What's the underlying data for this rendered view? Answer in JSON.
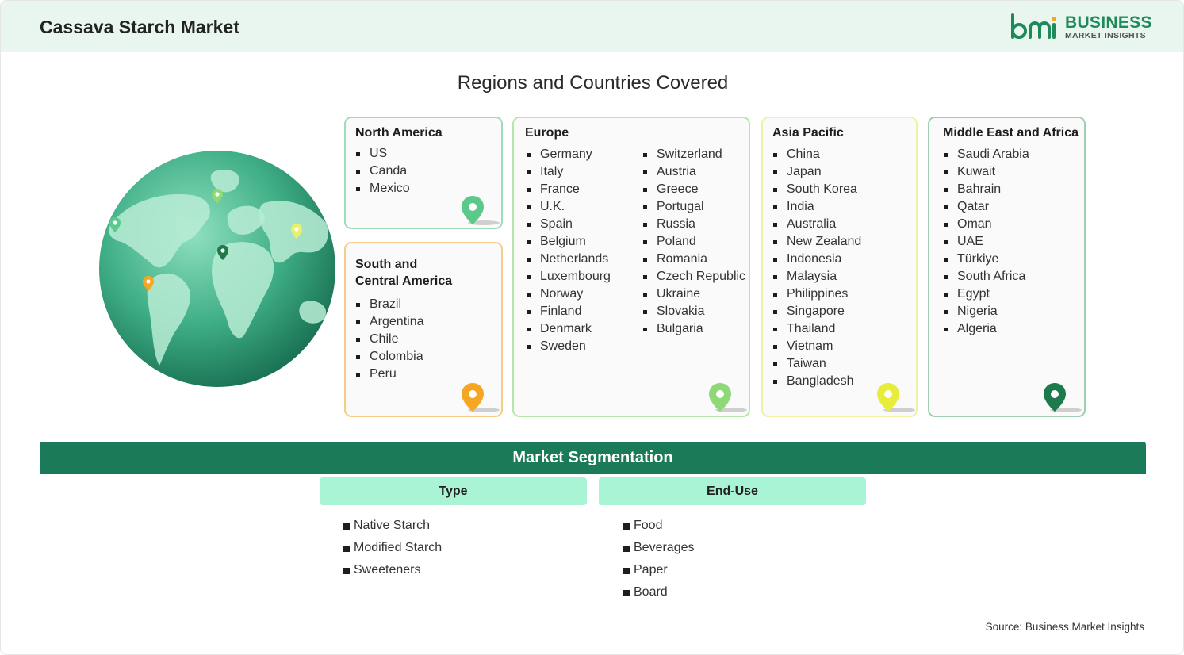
{
  "header": {
    "title": "Cassava Starch Market"
  },
  "logo": {
    "line1": "BUSINESS",
    "line2": "MARKET INSIGHTS",
    "brand_color": "#1e8a5a"
  },
  "regions_title": "Regions and Countries Covered",
  "regions": {
    "north_america": {
      "title": "North America",
      "color": "#5cc98a",
      "items": [
        "US",
        "Canda",
        "Mexico"
      ]
    },
    "south_central_america": {
      "title_line1": "South and",
      "title_line2": "Central America",
      "color": "#f5a623",
      "items": [
        "Brazil",
        "Argentina",
        "Chile",
        "Colombia",
        "Peru"
      ]
    },
    "europe": {
      "title": "Europe",
      "color": "#8ed876",
      "col1": [
        "Germany",
        "Italy",
        "France",
        "U.K.",
        "Spain",
        "Belgium",
        "Netherlands",
        "Luxembourg",
        "Norway",
        "Finland",
        "Denmark",
        "Sweden"
      ],
      "col2": [
        "Switzerland",
        "Austria",
        "Greece",
        "Portugal",
        "Russia",
        "Poland",
        "Romania",
        "Czech Republic",
        "Ukraine",
        "Slovakia",
        "Bulgaria"
      ]
    },
    "asia_pacific": {
      "title": "Asia Pacific",
      "color": "#eaf06a",
      "items": [
        "China",
        "Japan",
        "South Korea",
        "India",
        "Australia",
        "New Zealand",
        "Indonesia",
        "Malaysia",
        "Philippines",
        "Singapore",
        "Thailand",
        "Vietnam",
        "Taiwan",
        "Bangladesh"
      ]
    },
    "middle_east_africa": {
      "title": "Middle East and Africa",
      "color": "#1e7a4a",
      "items": [
        "Saudi Arabia",
        "Kuwait",
        "Bahrain",
        "Qatar",
        "Oman",
        "UAE",
        "Türkiye",
        "South Africa",
        "Egypt",
        "Nigeria",
        "Algeria"
      ]
    }
  },
  "segmentation": {
    "title": "Market Segmentation",
    "type": {
      "label": "Type",
      "items": [
        "Native Starch",
        "Modified Starch",
        "Sweeteners"
      ]
    },
    "end_use": {
      "label": "End-Use",
      "items": [
        "Food",
        "Beverages",
        "Paper",
        "Board"
      ]
    }
  },
  "source": "Source: Business Market Insights"
}
